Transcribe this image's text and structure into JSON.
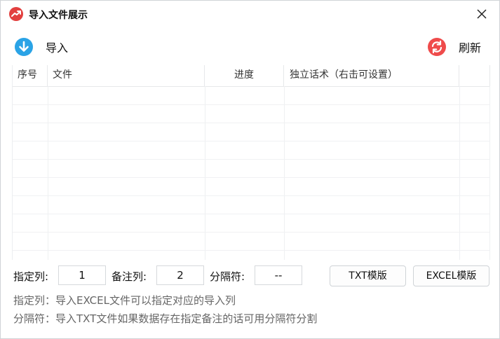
{
  "window": {
    "title": "导入文件展示"
  },
  "toolbar": {
    "import_label": "导入",
    "refresh_label": "刷新"
  },
  "table": {
    "headers": [
      "序号",
      "文件",
      "进度",
      "独立话术（右击可设置）",
      ""
    ],
    "rows": []
  },
  "settings": {
    "column_label": "指定列:",
    "column_value": "1",
    "note_label": "备注列:",
    "note_value": "2",
    "separator_label": "分隔符:",
    "separator_value": "--",
    "txt_template_label": "TXT模版",
    "excel_template_label": "EXCEL模版"
  },
  "hints": {
    "column_hint": "指定列：导入EXCEL文件可以指定对应的导入列",
    "separator_hint": "分隔符：导入TXT文件如果数据存在指定备注的话可用分隔符分割"
  },
  "colors": {
    "import_icon": "#2aa3e6",
    "refresh_icon": "#ef4b4b",
    "app_icon": "#e2403f"
  }
}
